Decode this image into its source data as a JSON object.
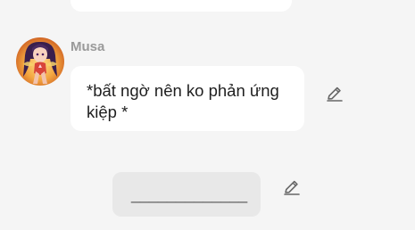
{
  "previous_message": {
    "text": ""
  },
  "message": {
    "sender": "Musa",
    "text": "*bất ngờ nên ko phản ứng kiệp *",
    "avatar_icon": "character-avatar"
  },
  "actions": {
    "edit_icon": "pencil-icon"
  },
  "pending_input": {
    "text": "_____________"
  },
  "colors": {
    "background": "#f5f5f5",
    "bubble": "#ffffff",
    "input_bubble": "#e8e8e8",
    "sender_name": "#9a9a9a",
    "message_text": "#1f1f1f",
    "icon": "#666666"
  }
}
